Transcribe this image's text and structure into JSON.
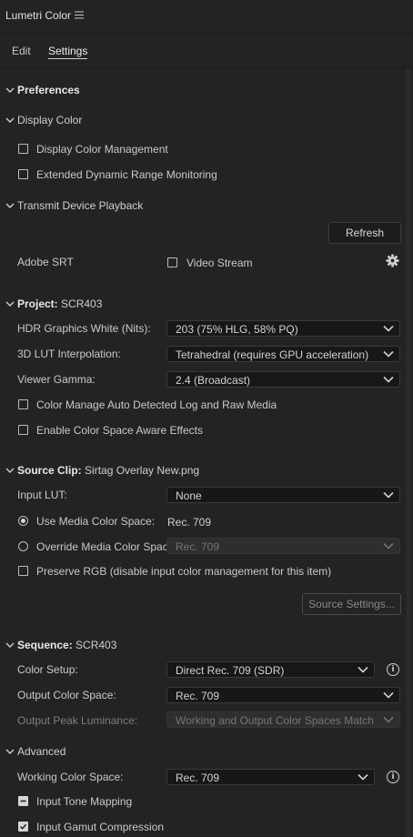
{
  "panel": {
    "title": "Lumetri Color",
    "menu_icon": "hamburger-icon"
  },
  "tabs": [
    {
      "label": "Edit",
      "active": false
    },
    {
      "label": "Settings",
      "active": true
    }
  ],
  "preferences": {
    "title": "Preferences"
  },
  "display_color": {
    "title": "Display Color",
    "options": [
      {
        "label": "Display Color Management",
        "checked": false
      },
      {
        "label": "Extended Dynamic Range Monitoring",
        "checked": false
      }
    ]
  },
  "transmit": {
    "title": "Transmit Device Playback",
    "refresh_label": "Refresh",
    "adobe_srt_label": "Adobe SRT",
    "video_stream_label": "Video Stream",
    "video_stream_checked": false,
    "settings_icon": "gear-icon"
  },
  "project": {
    "title_bold": "Project:",
    "title_rest": " SCR403",
    "hdr_label": "HDR Graphics White (Nits):",
    "hdr_value": "203 (75% HLG, 58% PQ)",
    "lut_label": "3D LUT Interpolation:",
    "lut_value": "Tetrahedral (requires GPU acceleration)",
    "gamma_label": "Viewer Gamma:",
    "gamma_value": "2.4 (Broadcast)",
    "auto_detect_label": "Color Manage Auto Detected Log and Raw Media",
    "aware_effects_label": "Enable Color Space Aware Effects"
  },
  "source_clip": {
    "title_bold": "Source Clip:",
    "title_rest": " Sirtag Overlay New.png",
    "input_lut_label": "Input LUT:",
    "input_lut_value": "None",
    "use_media_label": "Use Media Color Space:",
    "use_media_value": "Rec. 709",
    "override_label": "Override Media Color Space:",
    "override_value": "Rec. 709",
    "preserve_rgb_label": "Preserve RGB (disable input color management for this item)",
    "source_settings_label": "Source Settings..."
  },
  "sequence": {
    "title_bold": "Sequence:",
    "title_rest": " SCR403",
    "color_setup_label": "Color Setup:",
    "color_setup_value": "Direct Rec. 709 (SDR)",
    "output_space_label": "Output Color Space:",
    "output_space_value": "Rec. 709",
    "peak_label": "Output Peak Luminance:",
    "peak_value": "Working and Output Color Spaces Match"
  },
  "advanced": {
    "title": "Advanced",
    "working_label": "Working Color Space:",
    "working_value": "Rec. 709",
    "tone_mapping_label": "Input Tone Mapping",
    "gamut_label": "Input Gamut Compression"
  },
  "colors": {
    "background": "#232323",
    "field_bg": "#171717",
    "text": "#d6d6d6"
  }
}
